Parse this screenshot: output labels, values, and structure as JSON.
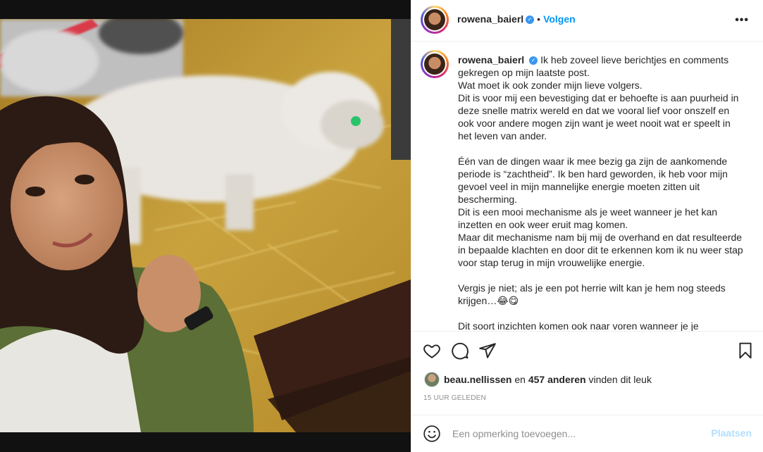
{
  "post": {
    "username": "rowena_baierl",
    "verified_icon": "verified-badge-icon",
    "separator": "•",
    "follow_label": "Volgen",
    "more_icon": "•••",
    "caption": "Ik heb zoveel lieve berichtjes en comments gekregen op mijn laatste post.\nWat moet ik ook zonder mijn lieve volgers.\nDit is voor mij een bevestiging dat er behoefte is aan puurheid in deze snelle matrix wereld en dat we vooral lief voor onszelf en ook voor andere mogen zijn want je weet nooit wat er speelt in het leven van ander.\n\nÉén van de dingen waar ik mee bezig ga zijn de aankomende periode is “zachtheid”. Ik ben hard geworden, ik heb voor mijn gevoel veel in mijn mannelijke energie moeten zitten uit bescherming.\nDit is een mooi mechanisme als je weet wanneer je het kan inzetten en ook weer eruit mag komen.\nMaar dit mechanisme nam bij mij de overhand en dat resulteerde in bepaalde klachten en door dit te erkennen kom ik nu weer stap voor stap terug in mijn vrouwelijke energie.\n\nVergis je niet; als je een pot herrie wilt kan je hem nog steeds krijgen…😂😋\n\nDit soort inzichten komen ook naar voren wanneer je je"
  },
  "likes": {
    "liker": "beau.nellissen",
    "connector": "en",
    "others": "457 anderen",
    "suffix": "vinden dit leuk"
  },
  "timestamp": "15 UUR GELEDEN",
  "comment": {
    "placeholder": "Een opmerking toevoegen...",
    "post_label": "Plaatsen"
  },
  "colors": {
    "accent": "#0095f6",
    "post_disabled": "#b2dffc",
    "muted": "#8e8e8e"
  }
}
